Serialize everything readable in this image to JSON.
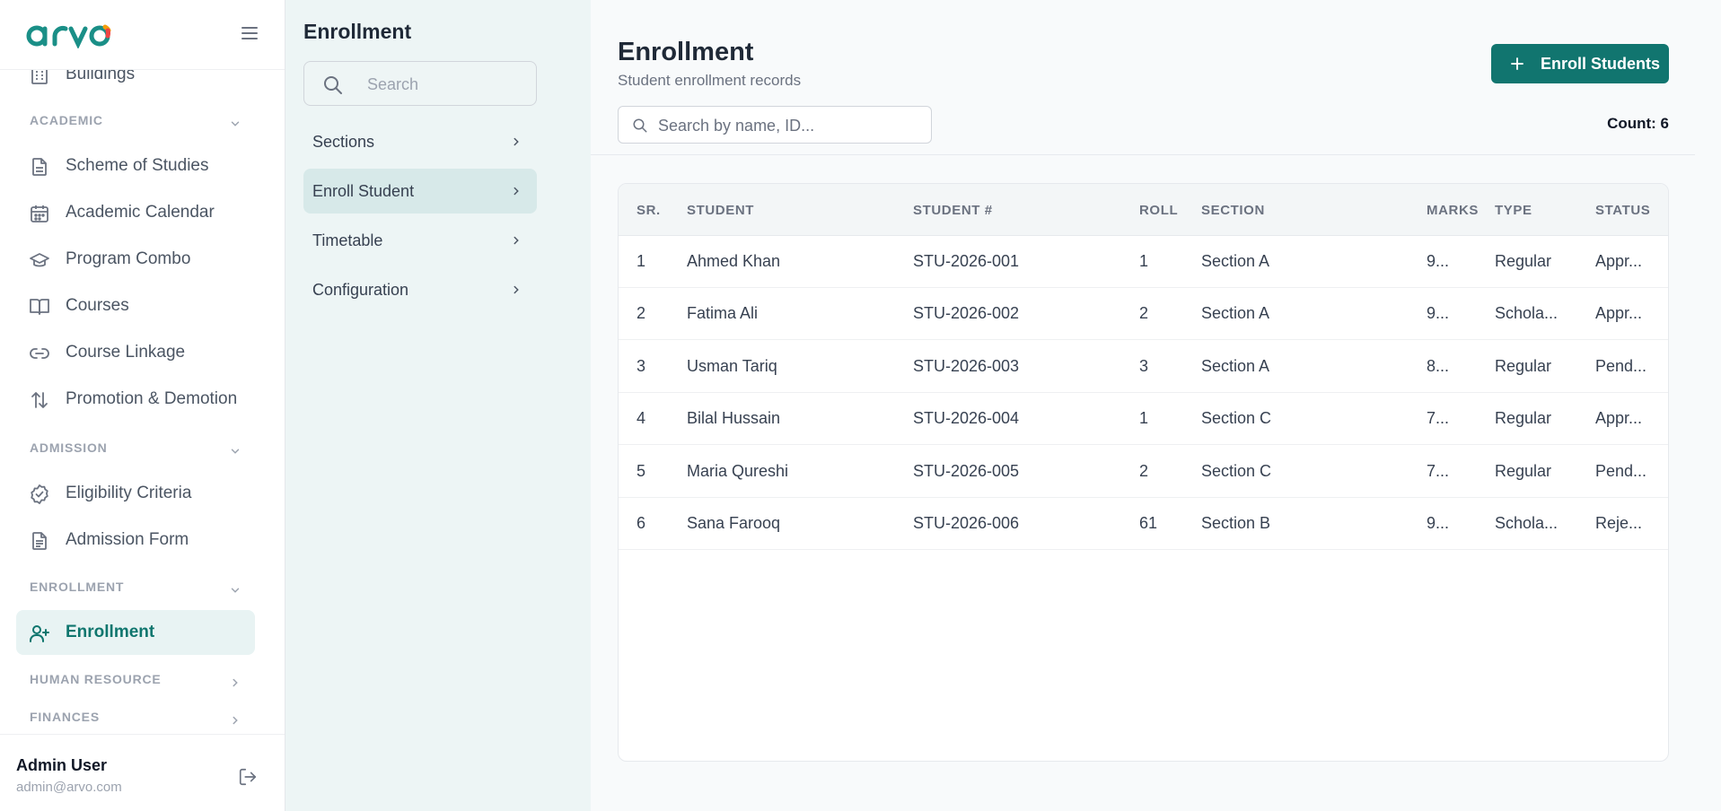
{
  "app": {
    "logo_text": "arvo"
  },
  "sidebar": {
    "top_item": {
      "label": "Buildings",
      "icon": "building-icon"
    },
    "sections": [
      {
        "title": "ACADEMIC",
        "expanded": true,
        "items": [
          {
            "label": "Scheme of Studies",
            "icon": "document-icon"
          },
          {
            "label": "Academic Calendar",
            "icon": "calendar-icon"
          },
          {
            "label": "Program Combo",
            "icon": "graduation-cap-icon"
          },
          {
            "label": "Courses",
            "icon": "book-icon"
          },
          {
            "label": "Course Linkage",
            "icon": "link-icon"
          },
          {
            "label": "Promotion & Demotion",
            "icon": "arrows-up-down-icon"
          }
        ]
      },
      {
        "title": "ADMISSION",
        "expanded": true,
        "items": [
          {
            "label": "Eligibility Criteria",
            "icon": "check-circle-icon"
          },
          {
            "label": "Admission Form",
            "icon": "form-icon"
          }
        ]
      },
      {
        "title": "ENROLLMENT",
        "expanded": true,
        "items": [
          {
            "label": "Enrollment",
            "icon": "user-plus-icon",
            "active": true
          }
        ]
      },
      {
        "title": "HUMAN RESOURCE",
        "expanded": false,
        "items": []
      },
      {
        "title": "FINANCES",
        "expanded": false,
        "items": []
      }
    ],
    "user": {
      "name": "Admin User",
      "email": "admin@arvo.com"
    }
  },
  "subpanel": {
    "title": "Enrollment",
    "search_placeholder": "Search",
    "items": [
      {
        "label": "Sections",
        "active": false
      },
      {
        "label": "Enroll Student",
        "active": true
      },
      {
        "label": "Timetable",
        "active": false
      },
      {
        "label": "Configuration",
        "active": false
      }
    ]
  },
  "main": {
    "title": "Enrollment",
    "subtitle": "Student enrollment records",
    "enroll_button_label": "Enroll Students",
    "search_placeholder": "Search by name, ID...",
    "count_label": "Count: 6",
    "accent_color": "#11756f",
    "table": {
      "columns": [
        "SR.",
        "STUDENT",
        "STUDENT #",
        "ROLL",
        "SECTION",
        "MARKS",
        "TYPE",
        "STATUS"
      ],
      "rows": [
        [
          "1",
          "Ahmed Khan",
          "STU-2026-001",
          "1",
          "Section A",
          "9...",
          "Regular",
          "Appr..."
        ],
        [
          "2",
          "Fatima Ali",
          "STU-2026-002",
          "2",
          "Section A",
          "9...",
          "Schola...",
          "Appr..."
        ],
        [
          "3",
          "Usman Tariq",
          "STU-2026-003",
          "3",
          "Section A",
          "8...",
          "Regular",
          "Pend..."
        ],
        [
          "4",
          "Bilal Hussain",
          "STU-2026-004",
          "1",
          "Section C",
          "7...",
          "Regular",
          "Appr..."
        ],
        [
          "5",
          "Maria Qureshi",
          "STU-2026-005",
          "2",
          "Section C",
          "7...",
          "Regular",
          "Pend..."
        ],
        [
          "6",
          "Sana Farooq",
          "STU-2026-006",
          "61",
          "Section B",
          "9...",
          "Schola...",
          "Reje..."
        ]
      ]
    }
  }
}
